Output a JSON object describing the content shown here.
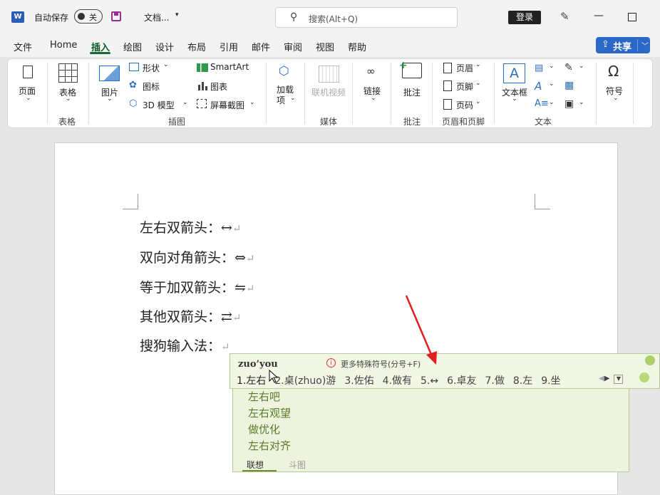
{
  "titlebar": {
    "app_logo": "W",
    "autosave_label": "自动保存",
    "autosave_state": "关",
    "doc_name": "文档...",
    "search_placeholder": "搜索(Alt+Q)",
    "login_label": "登录"
  },
  "menu": {
    "items": [
      "文件",
      "Home",
      "插入",
      "绘图",
      "设计",
      "布局",
      "引用",
      "邮件",
      "审阅",
      "视图",
      "帮助"
    ],
    "active": "插入",
    "share_label": "共享"
  },
  "ribbon": {
    "page": "页面",
    "table": "表格",
    "picture": "图片",
    "shapes": "形状",
    "icons": "图标",
    "model3d": "3D 模型",
    "smartart": "SmartArt",
    "chart": "图表",
    "screenshot": "屏幕截图",
    "addins": "加载项",
    "online_video": "联机视频",
    "link": "链接",
    "comment": "批注",
    "header": "页眉",
    "footer": "页脚",
    "page_number": "页码",
    "textbox": "文本框",
    "symbol": "符号",
    "groups": {
      "tables": "表格",
      "illustrations": "插图",
      "media": "媒体",
      "comments": "批注",
      "header_footer": "页眉和页脚",
      "text": "文本"
    }
  },
  "document": {
    "lines": [
      {
        "label": "左右双箭头：",
        "symbol": "↔"
      },
      {
        "label": "双向对角箭头：",
        "symbol": "⇔"
      },
      {
        "label": "等于加双箭头：",
        "symbol": "⇋"
      },
      {
        "label": "其他双箭头：",
        "symbol": "⇄"
      },
      {
        "label": "搜狗输入法：",
        "symbol": ""
      }
    ],
    "paragraph_mark": "↵"
  },
  "ime": {
    "pinyin": "zuo’you",
    "hint_icon": "i",
    "hint": "更多特殊符号(分号+F)",
    "candidates": [
      "1.左右",
      "2.桌(zhuo)游",
      "3.佐佑",
      "4.做有",
      "5.↔",
      "6.卓友",
      "7.做",
      "8.左",
      "9.坐"
    ],
    "associations": [
      "左右吧",
      "左右观望",
      "做优化",
      "左右对齐"
    ],
    "tabs": [
      "联想",
      "斗图"
    ]
  },
  "colors": {
    "accent": "#2b68c8",
    "active_tab": "#146b36",
    "ime_bg": "#eef3de",
    "annotation_arrow": "#e02020"
  }
}
